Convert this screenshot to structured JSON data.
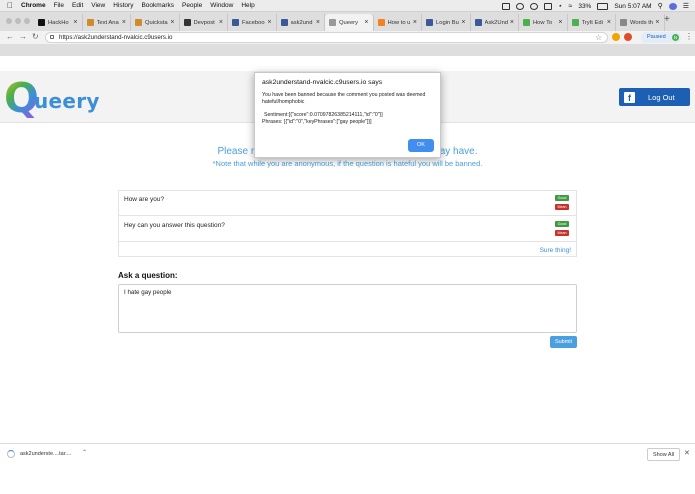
{
  "menubar": {
    "apple": "",
    "app": "Chrome",
    "items": [
      "File",
      "Edit",
      "View",
      "History",
      "Bookmarks",
      "People",
      "Window",
      "Help"
    ],
    "battery": "33%",
    "clock": "Sun 5:07 AM"
  },
  "tabs": [
    {
      "label": "HackHo",
      "color": "#111111"
    },
    {
      "label": "Text Ana",
      "color": "#d18a2c"
    },
    {
      "label": "Quicksta",
      "color": "#d18a2c"
    },
    {
      "label": "Devpost",
      "color": "#333333"
    },
    {
      "label": "Faceboo",
      "color": "#3b5998"
    },
    {
      "label": "ask2und",
      "color": "#3b5998"
    },
    {
      "label": "Queery",
      "color": "#999999",
      "active": true
    },
    {
      "label": "How to u",
      "color": "#f48024"
    },
    {
      "label": "Login Bu",
      "color": "#3b5998"
    },
    {
      "label": "Ask2Und",
      "color": "#3b5998"
    },
    {
      "label": "How To",
      "color": "#4caf50"
    },
    {
      "label": "TryIt Edi",
      "color": "#4caf50"
    },
    {
      "label": "Words th",
      "color": "#888888"
    }
  ],
  "address": {
    "url": "https://ask2understand-nvalcic.c9users.io",
    "profile_label": "Paused",
    "profile_initial": "N"
  },
  "header": {
    "logo_letter": "Q",
    "logo_rest": "ueery",
    "logout_label": "Log Out",
    "fb_glyph": "f"
  },
  "page": {
    "headline_left": "Please r",
    "headline_right": "ay have.",
    "note": "*Note that while you are anonymous, if the question is hateful you will be banned."
  },
  "questions": [
    {
      "text": "How are you?",
      "good": "Good",
      "mean": "Mean"
    },
    {
      "text": "Hey can you answer this question?",
      "good": "Good",
      "mean": "Mean"
    }
  ],
  "reply_link": "Sure thing!",
  "ask": {
    "heading": "Ask a question:",
    "value": "I hate gay people",
    "submit": "Submit"
  },
  "dialog": {
    "title": "ask2understand-nvalcic.c9users.io says",
    "line1": "You have been banned because the comment you posted was deemed hateful/homphobic",
    "line2": "Sentiment:[{\"score\":0.07097826385214111,\"id\":\"0\"}]",
    "line3": "Phrases: [{\"id\":\"0\",\"keyPhrases\":[\"gay people\"]}]",
    "ok": "OK"
  },
  "download": {
    "filename": "ask2underste....tar....",
    "show_all": "Show All"
  }
}
